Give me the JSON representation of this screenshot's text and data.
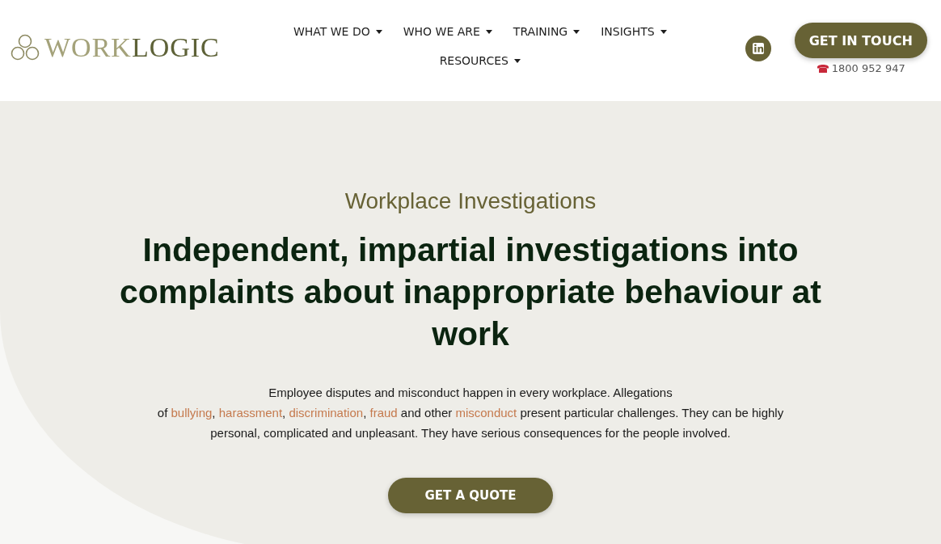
{
  "logo": {
    "light": "WORK",
    "dark": "LOGIC"
  },
  "nav": [
    {
      "label": "WHAT WE DO"
    },
    {
      "label": "WHO WE ARE"
    },
    {
      "label": "TRAINING"
    },
    {
      "label": "INSIGHTS"
    },
    {
      "label": "RESOURCES"
    }
  ],
  "contact": {
    "button": "GET IN TOUCH",
    "phone": "1800 952 947"
  },
  "hero": {
    "eyebrow": "Workplace Investigations",
    "heading": "Independent, impartial investigations into complaints about inappropriate behaviour at work",
    "lines": [
      [
        {
          "kind": "text",
          "text": "Employee disputes and misconduct happen in every workplace. Allegations"
        }
      ],
      [
        {
          "kind": "text",
          "text": "of "
        },
        {
          "kind": "link",
          "text": "bullying"
        },
        {
          "kind": "text",
          "text": ", "
        },
        {
          "kind": "link",
          "text": "harassment"
        },
        {
          "kind": "text",
          "text": ", "
        },
        {
          "kind": "link",
          "text": "discrimination"
        },
        {
          "kind": "text",
          "text": ", "
        },
        {
          "kind": "link",
          "text": "fraud"
        },
        {
          "kind": "text",
          "text": " and other "
        },
        {
          "kind": "link",
          "text": "misconduct"
        },
        {
          "kind": "text",
          "text": " present particular challenges. They can be highly"
        }
      ],
      [
        {
          "kind": "text",
          "text": "personal, complicated and unpleasant. They have serious consequences for the people involved."
        }
      ]
    ],
    "button": "GET A QUOTE"
  }
}
